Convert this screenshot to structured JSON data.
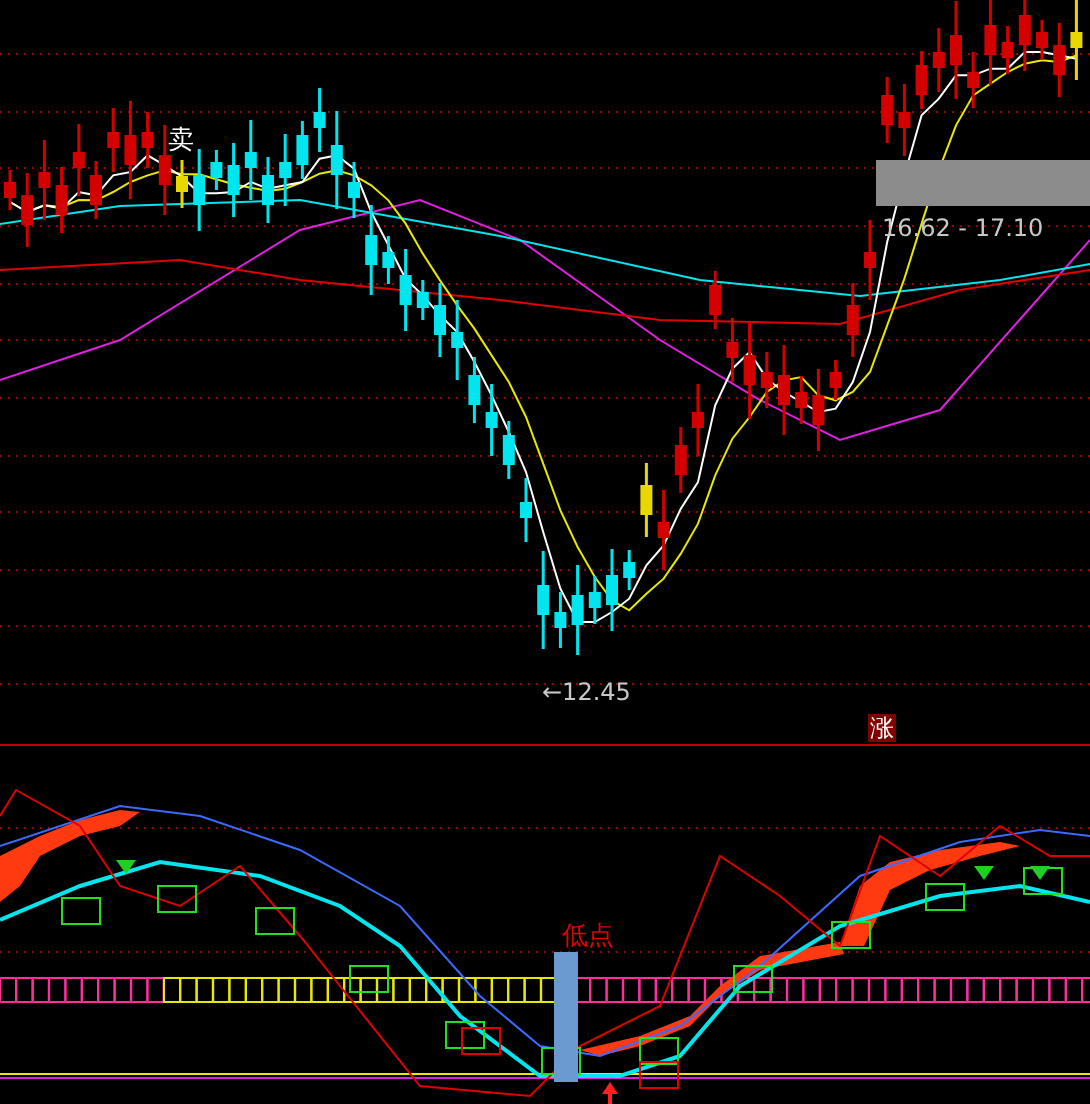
{
  "price_panel": {
    "sell_marker": "卖",
    "price_range": "16.62 - 17.10",
    "low_price": "←12.45",
    "rise_marker": "涨"
  },
  "indicator_panel": {
    "low_point_label": "低点"
  }
}
